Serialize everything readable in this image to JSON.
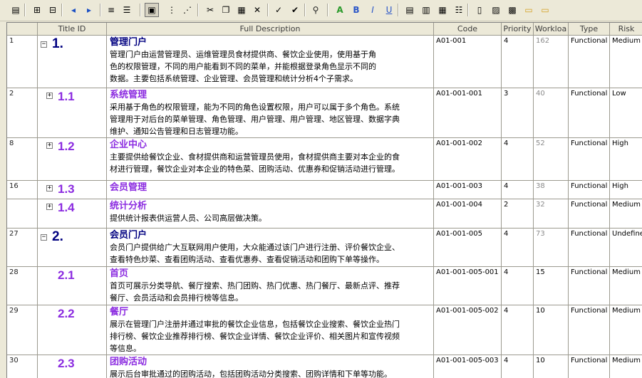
{
  "toolbar": {
    "icons": [
      "properties-icon",
      "indent-table-icon",
      "outdent-table-icon",
      "arrow-left-icon",
      "arrow-right-icon",
      "align-lines-icon",
      "justify-lines-icon",
      "outline-view-icon",
      "numbering-icon",
      "renumber-icon",
      "cut-icon",
      "copy-icon",
      "paste-icon",
      "delete-icon",
      "spell-check-icon",
      "spell-check-all-icon",
      "find-icon",
      "font-a-icon",
      "bold-icon",
      "italic-icon",
      "underline-icon",
      "align-left-icon",
      "align-center-icon",
      "align-right-icon",
      "bullet-list-icon",
      "new-doc-icon",
      "image-icon",
      "edit-image-icon",
      "open-folder-icon",
      "open-folder-2-icon"
    ]
  },
  "columns": {
    "id": "",
    "title": "Title ID",
    "desc": "Full Description",
    "code": "Code",
    "priority": "Priority",
    "workload": "Workloa",
    "type": "Type",
    "risk": "Risk"
  },
  "rows": [
    {
      "id": "1",
      "num": "1.",
      "level": 1,
      "expander": "−",
      "title": "管理门户",
      "text": "管理门户由运营管理员、运维管理员食材提供商、餐饮企业使用，使用基于角\n色的权限管理，不同的用户能看到不同的菜单，并能根据登录角色显示不同的\n数据。主要包括系统管理、企业管理、会员管理和统计分析4个子需求。",
      "code": "A01-001",
      "priority": "4",
      "workload": "162",
      "type": "Functional",
      "risk": "Medium"
    },
    {
      "id": "2",
      "num": "1.1",
      "level": 2,
      "expander": "+",
      "title": "系统管理",
      "text": "采用基于角色的权限管理，能为不同的角色设置权限，用户可以属于多个角色。系统\n管理用于对后台的菜单管理、角色管理、用户管理、用户管理、地区管理、数据字典\n维护、通知公告管理和日志管理功能。",
      "code": "A01-001-001",
      "priority": "3",
      "workload": "40",
      "type": "Functional",
      "risk": "Low"
    },
    {
      "id": "8",
      "num": "1.2",
      "level": 2,
      "expander": "+",
      "title": "企业中心",
      "text": "主要提供给餐饮企业、食材提供商和运营管理员使用，食材提供商主要对本企业的食\n材进行管理，餐饮企业对本企业的特色菜、团购活动、优惠券和促销活动进行管理。",
      "code": "A01-001-002",
      "priority": "4",
      "workload": "52",
      "type": "Functional",
      "risk": "High"
    },
    {
      "id": "16",
      "num": "1.3",
      "level": 2,
      "expander": "+",
      "title": "会员管理",
      "text": "",
      "code": "A01-001-003",
      "priority": "4",
      "workload": "38",
      "type": "Functional",
      "risk": "High"
    },
    {
      "id": "",
      "num": "1.4",
      "level": 2,
      "expander": "+",
      "title": "统计分析",
      "text": "提供统计报表供运营人员、公司高层做决策。",
      "code": "A01-001-004",
      "priority": "2",
      "workload": "32",
      "type": "Functional",
      "risk": "Medium",
      "current": true
    },
    {
      "id": "27",
      "num": "2.",
      "level": 1,
      "expander": "−",
      "title": "会员门户",
      "text": "会员门户提供给广大互联网用户使用，大众能通过该门户进行注册、评价餐饮企业、\n查看特色炒菜、查看团购活动、查看优惠券、查看促销活动和团购下单等操作。",
      "code": "A01-001-005",
      "priority": "4",
      "workload": "73",
      "type": "Functional",
      "risk": "Undefine"
    },
    {
      "id": "28",
      "num": "2.1",
      "level": 2,
      "expander": "",
      "title": "首页",
      "text": "首页可展示分类导航、餐厅搜索、热门团购、热门优惠、热门餐厅、最新点评、推荐\n餐厅、会员活动和会员排行榜等信息。",
      "code": "A01-001-005-001",
      "priority": "4",
      "workload": "15",
      "type": "Functional",
      "risk": "Medium"
    },
    {
      "id": "29",
      "num": "2.2",
      "level": 2,
      "expander": "",
      "title": "餐厅",
      "text": "展示在管理门户注册并通过审批的餐饮企业信息，包括餐饮企业搜索、餐饮企业热门\n排行榜、餐饮企业推荐排行榜、餐饮企业详情、餐饮企业评价、相关图片和宣传视频\n等信息。",
      "code": "A01-001-005-002",
      "priority": "4",
      "workload": "10",
      "type": "Functional",
      "risk": "Medium"
    },
    {
      "id": "30",
      "num": "2.3",
      "level": 2,
      "expander": "",
      "title": "团购活动",
      "text": "展示后台审批通过的团购活动，包括团购活动分类搜索、团购详情和下单等功能。",
      "code": "A01-001-005-003",
      "priority": "4",
      "workload": "10",
      "type": "Functional",
      "risk": "Medium"
    }
  ]
}
